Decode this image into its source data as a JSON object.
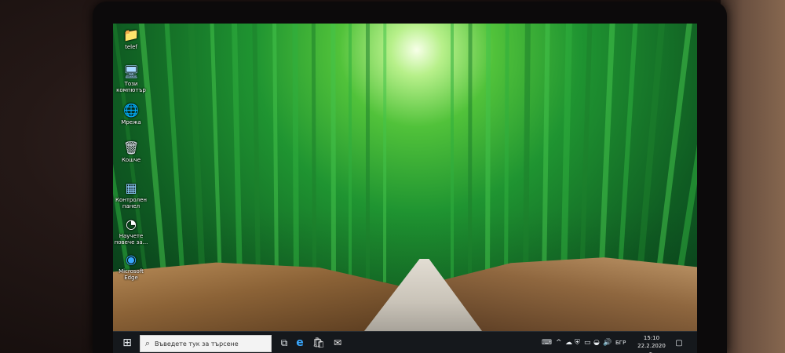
{
  "desktop": {
    "icons": [
      {
        "label": "telef",
        "icon": "folder-icon"
      },
      {
        "label": "Този компютър",
        "icon": "computer-icon"
      },
      {
        "label": "Мрежа",
        "icon": "network-icon"
      },
      {
        "label": "Кошче",
        "icon": "recycle-bin-icon"
      },
      {
        "label": "Контролен панел",
        "icon": "control-panel-icon"
      },
      {
        "label": "Научете повече за...",
        "icon": "learn-more-icon"
      },
      {
        "label": "Microsoft Edge",
        "icon": "edge-icon"
      }
    ]
  },
  "taskbar": {
    "start_glyph": "⊞",
    "search_placeholder": "Въведете тук за търсене",
    "pinned": [
      {
        "name": "task-view",
        "glyph": "⧉"
      },
      {
        "name": "edge",
        "glyph": "e"
      },
      {
        "name": "store",
        "glyph": "🛍"
      },
      {
        "name": "mail",
        "glyph": "✉"
      }
    ],
    "tray": {
      "language": "БГР",
      "time": "15:10",
      "date": "22.2.2020 г."
    }
  },
  "colors": {
    "taskbar_bg": "#15181c",
    "bamboo_green": "#1f9431",
    "edge_blue": "#39a8ff"
  }
}
